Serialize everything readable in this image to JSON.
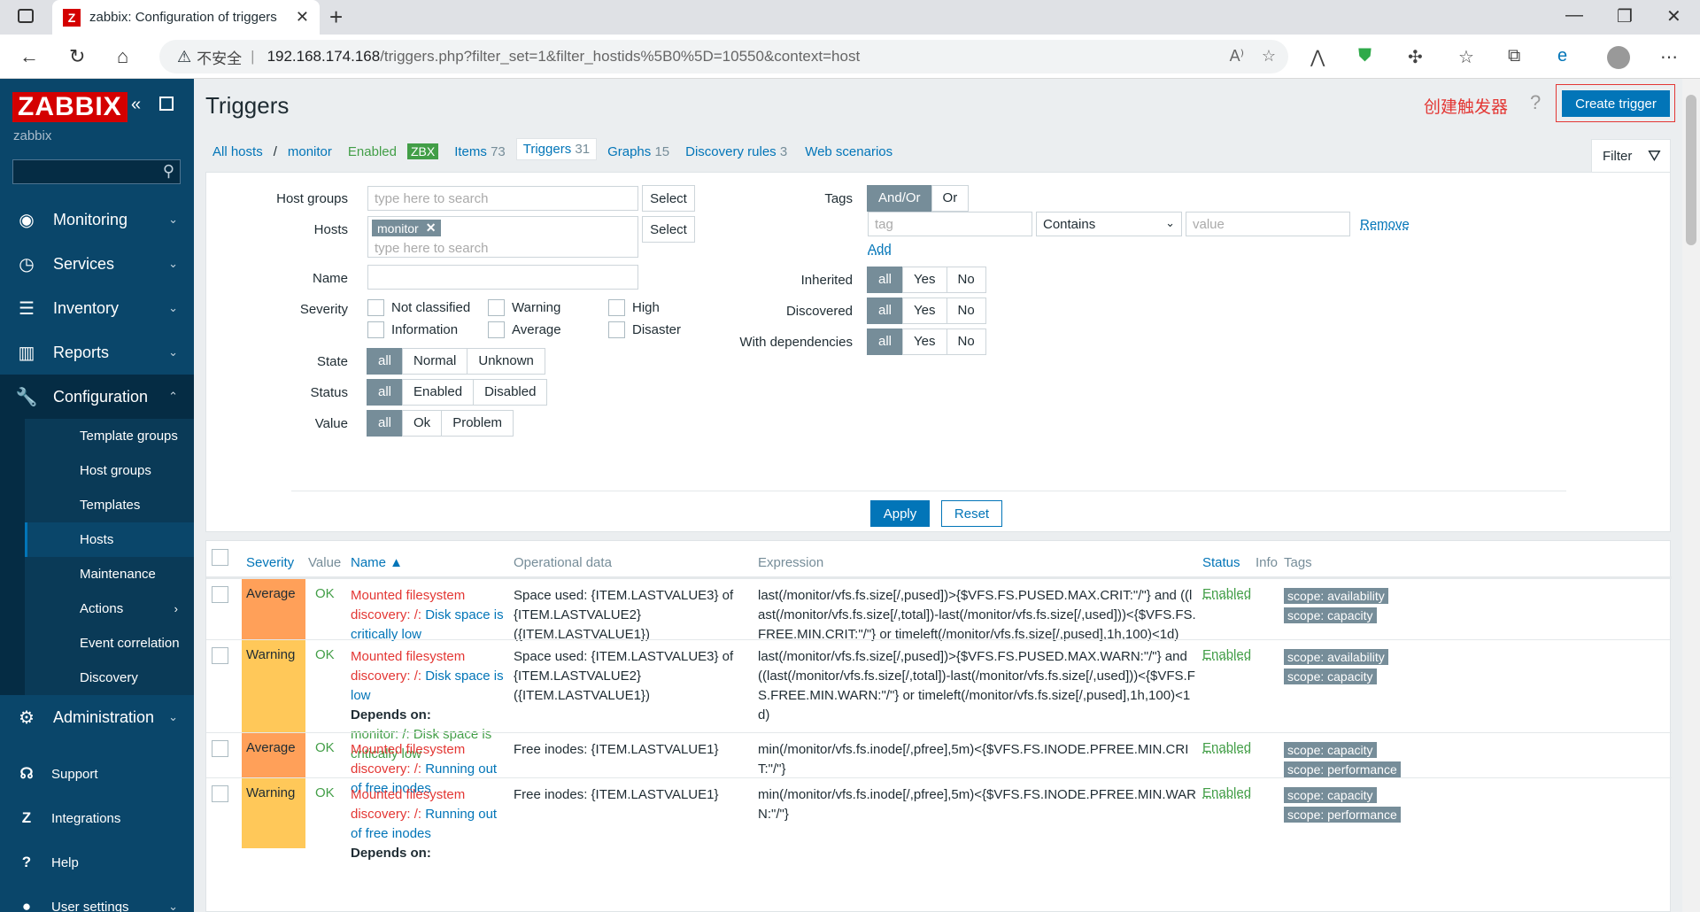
{
  "browser": {
    "tab_title": "zabbix: Configuration of triggers",
    "not_secure": "不安全",
    "url_host": "192.168.174.168",
    "url_path": "/triggers.php?filter_set=1&filter_hostids%5B0%5D=10550&context=host"
  },
  "sidebar": {
    "logo": "ZABBIX",
    "subtitle": "zabbix",
    "menu": [
      {
        "label": "Monitoring",
        "icon": "eye-icon"
      },
      {
        "label": "Services",
        "icon": "clock-icon"
      },
      {
        "label": "Inventory",
        "icon": "list-icon"
      },
      {
        "label": "Reports",
        "icon": "bar-chart-icon"
      },
      {
        "label": "Configuration",
        "icon": "wrench-icon"
      }
    ],
    "config_sub": [
      "Template groups",
      "Host groups",
      "Templates",
      "Hosts",
      "Maintenance",
      "Actions",
      "Event correlation",
      "Discovery"
    ],
    "admin": "Administration",
    "bottom": [
      "Support",
      "Integrations",
      "Help",
      "User settings"
    ]
  },
  "header": {
    "title": "Triggers",
    "annotation": "创建触发器",
    "create_btn": "Create trigger"
  },
  "nav": {
    "all_hosts": "All hosts",
    "sep": "/",
    "host": "monitor",
    "enabled": "Enabled",
    "zbx": "ZBX",
    "items": "Items",
    "items_count": "73",
    "triggers": "Triggers",
    "triggers_count": "31",
    "graphs": "Graphs",
    "graphs_count": "15",
    "discovery": "Discovery rules",
    "discovery_count": "3",
    "web": "Web scenarios",
    "filter": "Filter"
  },
  "filter": {
    "host_groups": "Host groups",
    "hosts": "Hosts",
    "name": "Name",
    "severity": "Severity",
    "state": "State",
    "status": "Status",
    "value": "Value",
    "tags": "Tags",
    "inherited": "Inherited",
    "discovered": "Discovered",
    "with_deps": "With dependencies",
    "placeholder": "type here to search",
    "select": "Select",
    "chip": "monitor",
    "sev_opts": [
      "Not classified",
      "Information",
      "Warning",
      "Average",
      "High",
      "Disaster"
    ],
    "state_opts": [
      "all",
      "Normal",
      "Unknown"
    ],
    "status_opts": [
      "all",
      "Enabled",
      "Disabled"
    ],
    "value_opts": [
      "all",
      "Ok",
      "Problem"
    ],
    "andor": "And/Or",
    "or": "Or",
    "tag_ph": "tag",
    "contains": "Contains",
    "value_ph": "value",
    "remove": "Remove",
    "add": "Add",
    "yn": [
      "all",
      "Yes",
      "No"
    ],
    "apply": "Apply",
    "reset": "Reset"
  },
  "table": {
    "headers": {
      "severity": "Severity",
      "value": "Value",
      "name": "Name ▲",
      "opdata": "Operational data",
      "expression": "Expression",
      "status": "Status",
      "info": "Info",
      "tags": "Tags"
    },
    "rows": [
      {
        "severity": "Average",
        "color": "#ffa059",
        "value": "OK",
        "disc": "Mounted filesystem discovery: /:",
        "name": "Disk space is critically low",
        "dep": "",
        "depl": "",
        "op": "Space used: {ITEM.LASTVALUE3} of {ITEM.LASTVALUE2} ({ITEM.LASTVALUE1})",
        "expr": "last(/monitor/vfs.fs.size[/,pused])>{$VFS.FS.PUSED.MAX.CRIT:\"/\"} and ((last(/monitor/vfs.fs.size[/,total])-last(/monitor/vfs.fs.size[/,used]))<{$VFS.FS.FREE.MIN.CRIT:\"/\"} or timeleft(/monitor/vfs.fs.size[/,pused],1h,100)<1d)",
        "status": "Enabled",
        "tags": [
          "scope: availability",
          "scope: capacity"
        ]
      },
      {
        "severity": "Warning",
        "color": "#ffc859",
        "value": "OK",
        "disc": "Mounted filesystem discovery: /:",
        "name": "Disk space is low",
        "dep": "Depends on:",
        "depl": "monitor: /: Disk space is critically low",
        "op": "Space used: {ITEM.LASTVALUE3} of {ITEM.LASTVALUE2} ({ITEM.LASTVALUE1})",
        "expr": "last(/monitor/vfs.fs.size[/,pused])>{$VFS.FS.PUSED.MAX.WARN:\"/\"} and ((last(/monitor/vfs.fs.size[/,total])-last(/monitor/vfs.fs.size[/,used]))<{$VFS.FS.FREE.MIN.WARN:\"/\"} or timeleft(/monitor/vfs.fs.size[/,pused],1h,100)<1d)",
        "status": "Enabled",
        "tags": [
          "scope: availability",
          "scope: capacity"
        ]
      },
      {
        "severity": "Average",
        "color": "#ffa059",
        "value": "OK",
        "disc": "Mounted filesystem discovery: /:",
        "name": "Running out of free inodes",
        "dep": "",
        "depl": "",
        "op": "Free inodes: {ITEM.LASTVALUE1}",
        "expr": "min(/monitor/vfs.fs.inode[/,pfree],5m)<{$VFS.FS.INODE.PFREE.MIN.CRIT:\"/\"}",
        "status": "Enabled",
        "tags": [
          "scope: capacity",
          "scope: performance"
        ]
      },
      {
        "severity": "Warning",
        "color": "#ffc859",
        "value": "OK",
        "disc": "Mounted filesystem discovery: /:",
        "name": "Running out of free inodes",
        "dep": "Depends on:",
        "depl": "",
        "op": "Free inodes: {ITEM.LASTVALUE1}",
        "expr": "min(/monitor/vfs.fs.inode[/,pfree],5m)<{$VFS.FS.INODE.PFREE.MIN.WARN:\"/\"}",
        "status": "Enabled",
        "tags": [
          "scope: capacity",
          "scope: performance"
        ]
      }
    ]
  }
}
